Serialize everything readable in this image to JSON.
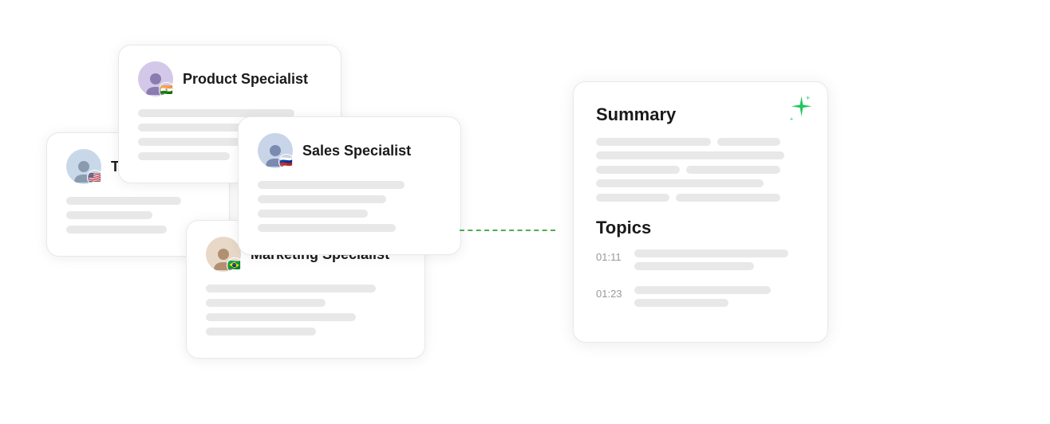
{
  "cards": {
    "team_lead": {
      "title": "Team Lead",
      "avatar_flag": "🇺🇸",
      "avatar_color": "#c8d8e8"
    },
    "product_specialist": {
      "title": "Product Specialist",
      "avatar_flag": "🇮🇳",
      "avatar_color": "#d4c8e8"
    },
    "sales_specialist": {
      "title": "Sales Specialist",
      "avatar_flag": "🇷🇺",
      "avatar_color": "#c8d4e8"
    },
    "marketing_specialist": {
      "title": "Marketing Specialist",
      "avatar_flag": "🇧🇷",
      "avatar_color": "#e8d8c8"
    }
  },
  "summary_panel": {
    "summary_label": "Summary",
    "topics_label": "Topics",
    "topic1_time": "01:11",
    "topic2_time": "01:23",
    "sparkle_label": "✦"
  }
}
